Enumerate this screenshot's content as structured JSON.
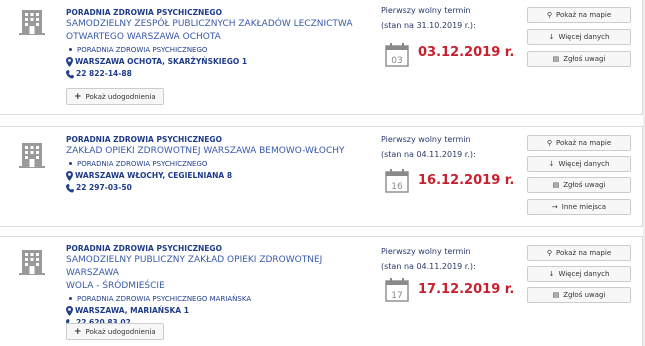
{
  "listings": [
    {
      "type": "PORADNIA ZDROWIA PSYCHICZNEGO",
      "name_line1": "SAMODZIELNY ZESPÓŁ PUBLICZNYCH ZAKŁADÓW LECZNICTWA",
      "name_line2": "OTWARTEGO WARSZAWA OCHOTA",
      "sub": "PORADNIA ZDROWIA PSYCHICZNEGO",
      "address": "WARSZAWA OCHOTA, SKARŻYŃSKIEGO 1",
      "phone": "22 822-14-88",
      "term_label": "Pierwszy wolny termin",
      "term_state": "(stan na 31.10.2019 r.):",
      "cal_day": "03",
      "date": "03.12.2019 r.",
      "notes_label": "Pokaż udogodnienia"
    },
    {
      "type": "PORADNIA ZDROWIA PSYCHICZNEGO",
      "name_line1": "ZAKŁAD OPIEKI ZDROWOTNEJ WARSZAWA BEMOWO-WŁOCHY",
      "sub": "PORADNIA ZDROWIA PSYCHICZNEGO",
      "address": "WARSZAWA WŁOCHY, CEGIELNIANA 8",
      "phone": "22 297-03-50",
      "term_label": "Pierwszy wolny termin",
      "term_state": "(stan na 04.11.2019 r.):",
      "cal_day": "16",
      "date": "16.12.2019 r.",
      "extra_button": "Inne miejsca"
    },
    {
      "type": "PORADNIA ZDROWIA PSYCHICZNEGO",
      "name_line1": "SAMODZIELNY PUBLICZNY ZAKŁAD OPIEKI ZDROWOTNEJ WARSZAWA",
      "name_line2": "WOLA - ŚRÓDMIEŚCIE",
      "sub": "PORADNIA ZDROWIA PSYCHICZNEGO MARIAŃSKA",
      "address": "WARSZAWA, MARIAŃSKA 1",
      "phone": "22 620 83 02",
      "term_label": "Pierwszy wolny termin",
      "term_state": "(stan na 04.11.2019 r.):",
      "cal_day": "17",
      "date": "17.12.2019 r.",
      "notes_label": "Pokaż udogodnienia"
    }
  ],
  "buttons": {
    "map": "Pokaż na mapie",
    "more": "Więcej danych",
    "report": "Zgłoś uwagi"
  },
  "colors": {
    "accent_blue": "#23408e",
    "date_red": "#c8202e",
    "icon_gray": "#9a9a9a"
  }
}
